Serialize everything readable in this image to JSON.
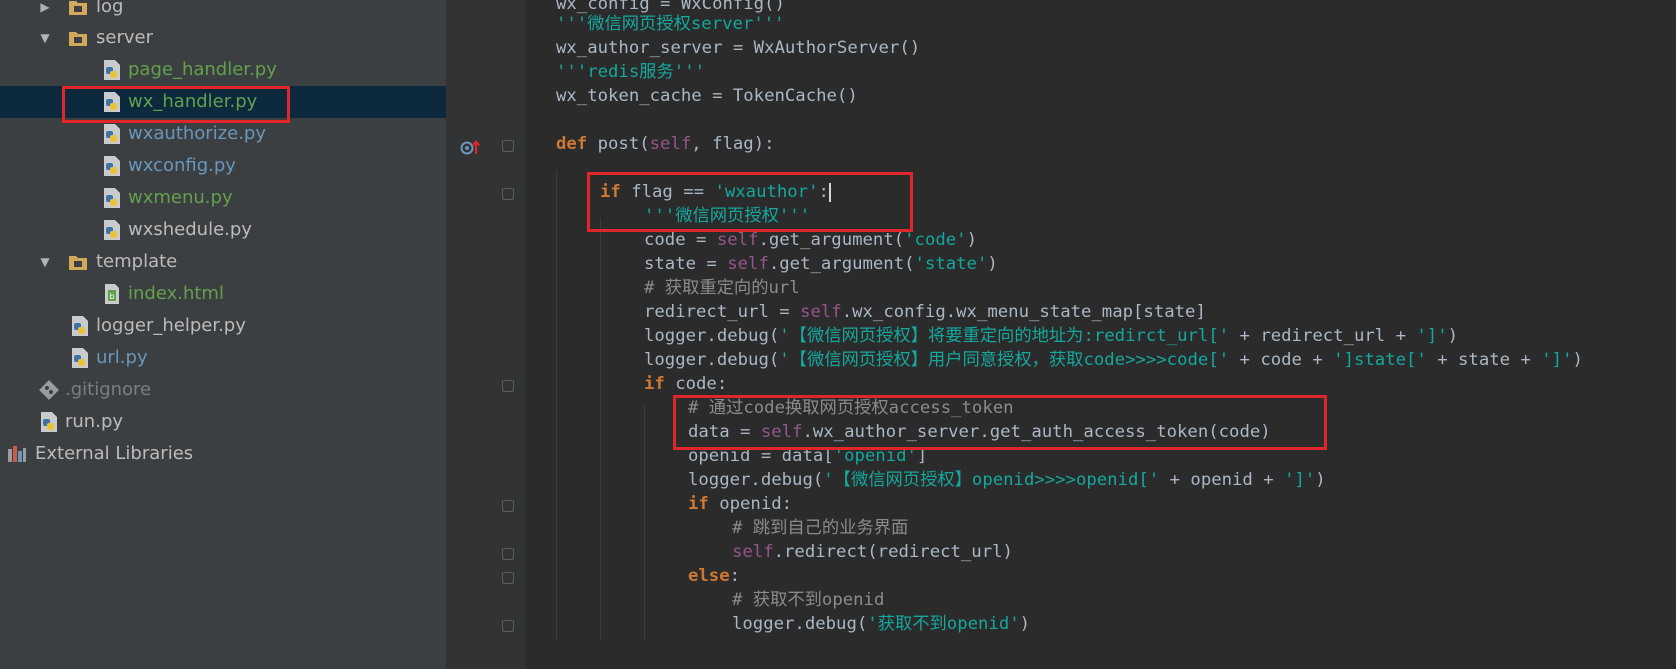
{
  "colors": {
    "tree_bg": "#3c3f41",
    "editor_bg": "#2b2b2b",
    "selection": "#0d293e",
    "highlight_box": "#e0262b",
    "green_file": "#62a14c",
    "blue_file": "#6897bb",
    "keyword": "#cc7832",
    "string": "#13a89e",
    "self": "#94558d"
  },
  "tree": {
    "items": [
      {
        "label": "log",
        "icon": "folder-icon",
        "expanded": false
      },
      {
        "label": "server",
        "icon": "folder-icon",
        "expanded": true
      },
      {
        "label": "page_handler.py",
        "icon": "python-file-icon"
      },
      {
        "label": "wx_handler.py",
        "icon": "python-file-icon",
        "selected": true
      },
      {
        "label": "wxauthorize.py",
        "icon": "python-file-icon"
      },
      {
        "label": "wxconfig.py",
        "icon": "python-file-icon"
      },
      {
        "label": "wxmenu.py",
        "icon": "python-file-icon"
      },
      {
        "label": "wxshedule.py",
        "icon": "python-file-icon"
      },
      {
        "label": "template",
        "icon": "folder-icon",
        "expanded": true
      },
      {
        "label": "index.html",
        "icon": "html-file-icon"
      },
      {
        "label": "logger_helper.py",
        "icon": "python-file-icon"
      },
      {
        "label": "url.py",
        "icon": "python-file-icon"
      },
      {
        "label": ".gitignore",
        "icon": "git-file-icon"
      },
      {
        "label": "run.py",
        "icon": "python-file-icon"
      },
      {
        "label": "External Libraries",
        "icon": "library-icon"
      }
    ]
  },
  "code": {
    "l1": [
      "wx_config = WxConfig()"
    ],
    "l2": [
      "'''微信网页授权server'''"
    ],
    "l3": [
      "wx_author_server = WxAuthorServer()"
    ],
    "l4": [
      "'''redis服务'''"
    ],
    "l5": [
      "wx_token_cache = TokenCache()"
    ],
    "l6": [
      "def",
      " post(",
      "self",
      ", flag):"
    ],
    "l7": [
      "if",
      " flag == ",
      "'wxauthor'",
      ":"
    ],
    "l8": [
      "'''微信网页授权'''"
    ],
    "l9": [
      "code = ",
      "self",
      ".get_argument(",
      "'code'",
      ")"
    ],
    "l10": [
      "state = ",
      "self",
      ".get_argument(",
      "'state'",
      ")"
    ],
    "l11": [
      "# 获取重定向的url"
    ],
    "l12": [
      "redirect_url = ",
      "self",
      ".wx_config.wx_menu_state_map[state]"
    ],
    "l13": [
      "logger.debug(",
      "'【微信网页授权】将要重定向的地址为:redirct_url['",
      " + redirect_url + ",
      "']'",
      ")"
    ],
    "l14": [
      "logger.debug(",
      "'【微信网页授权】用户同意授权，获取code>>>>code['",
      " + code + ",
      "']state['",
      " + state + ",
      "']'",
      ")"
    ],
    "l15": [
      "if",
      " code:"
    ],
    "l16": [
      "# 通过code换取网页授权access_token"
    ],
    "l17": [
      "data = ",
      "self",
      ".wx_author_server.get_auth_access_token(code)"
    ],
    "l18": [
      "openid = data[",
      "'openid'",
      "]"
    ],
    "l19": [
      "logger.debug(",
      "'【微信网页授权】openid>>>>openid['",
      " + openid + ",
      "']'",
      ")"
    ],
    "l20": [
      "if",
      " openid:"
    ],
    "l21": [
      "# 跳到自己的业务界面"
    ],
    "l22": [
      "self",
      ".redirect(redirect_url)"
    ],
    "l23": [
      "else",
      ":"
    ],
    "l24": [
      "# 获取不到openid"
    ],
    "l25": [
      "logger.debug(",
      "'获取不到openid'",
      ")"
    ]
  }
}
